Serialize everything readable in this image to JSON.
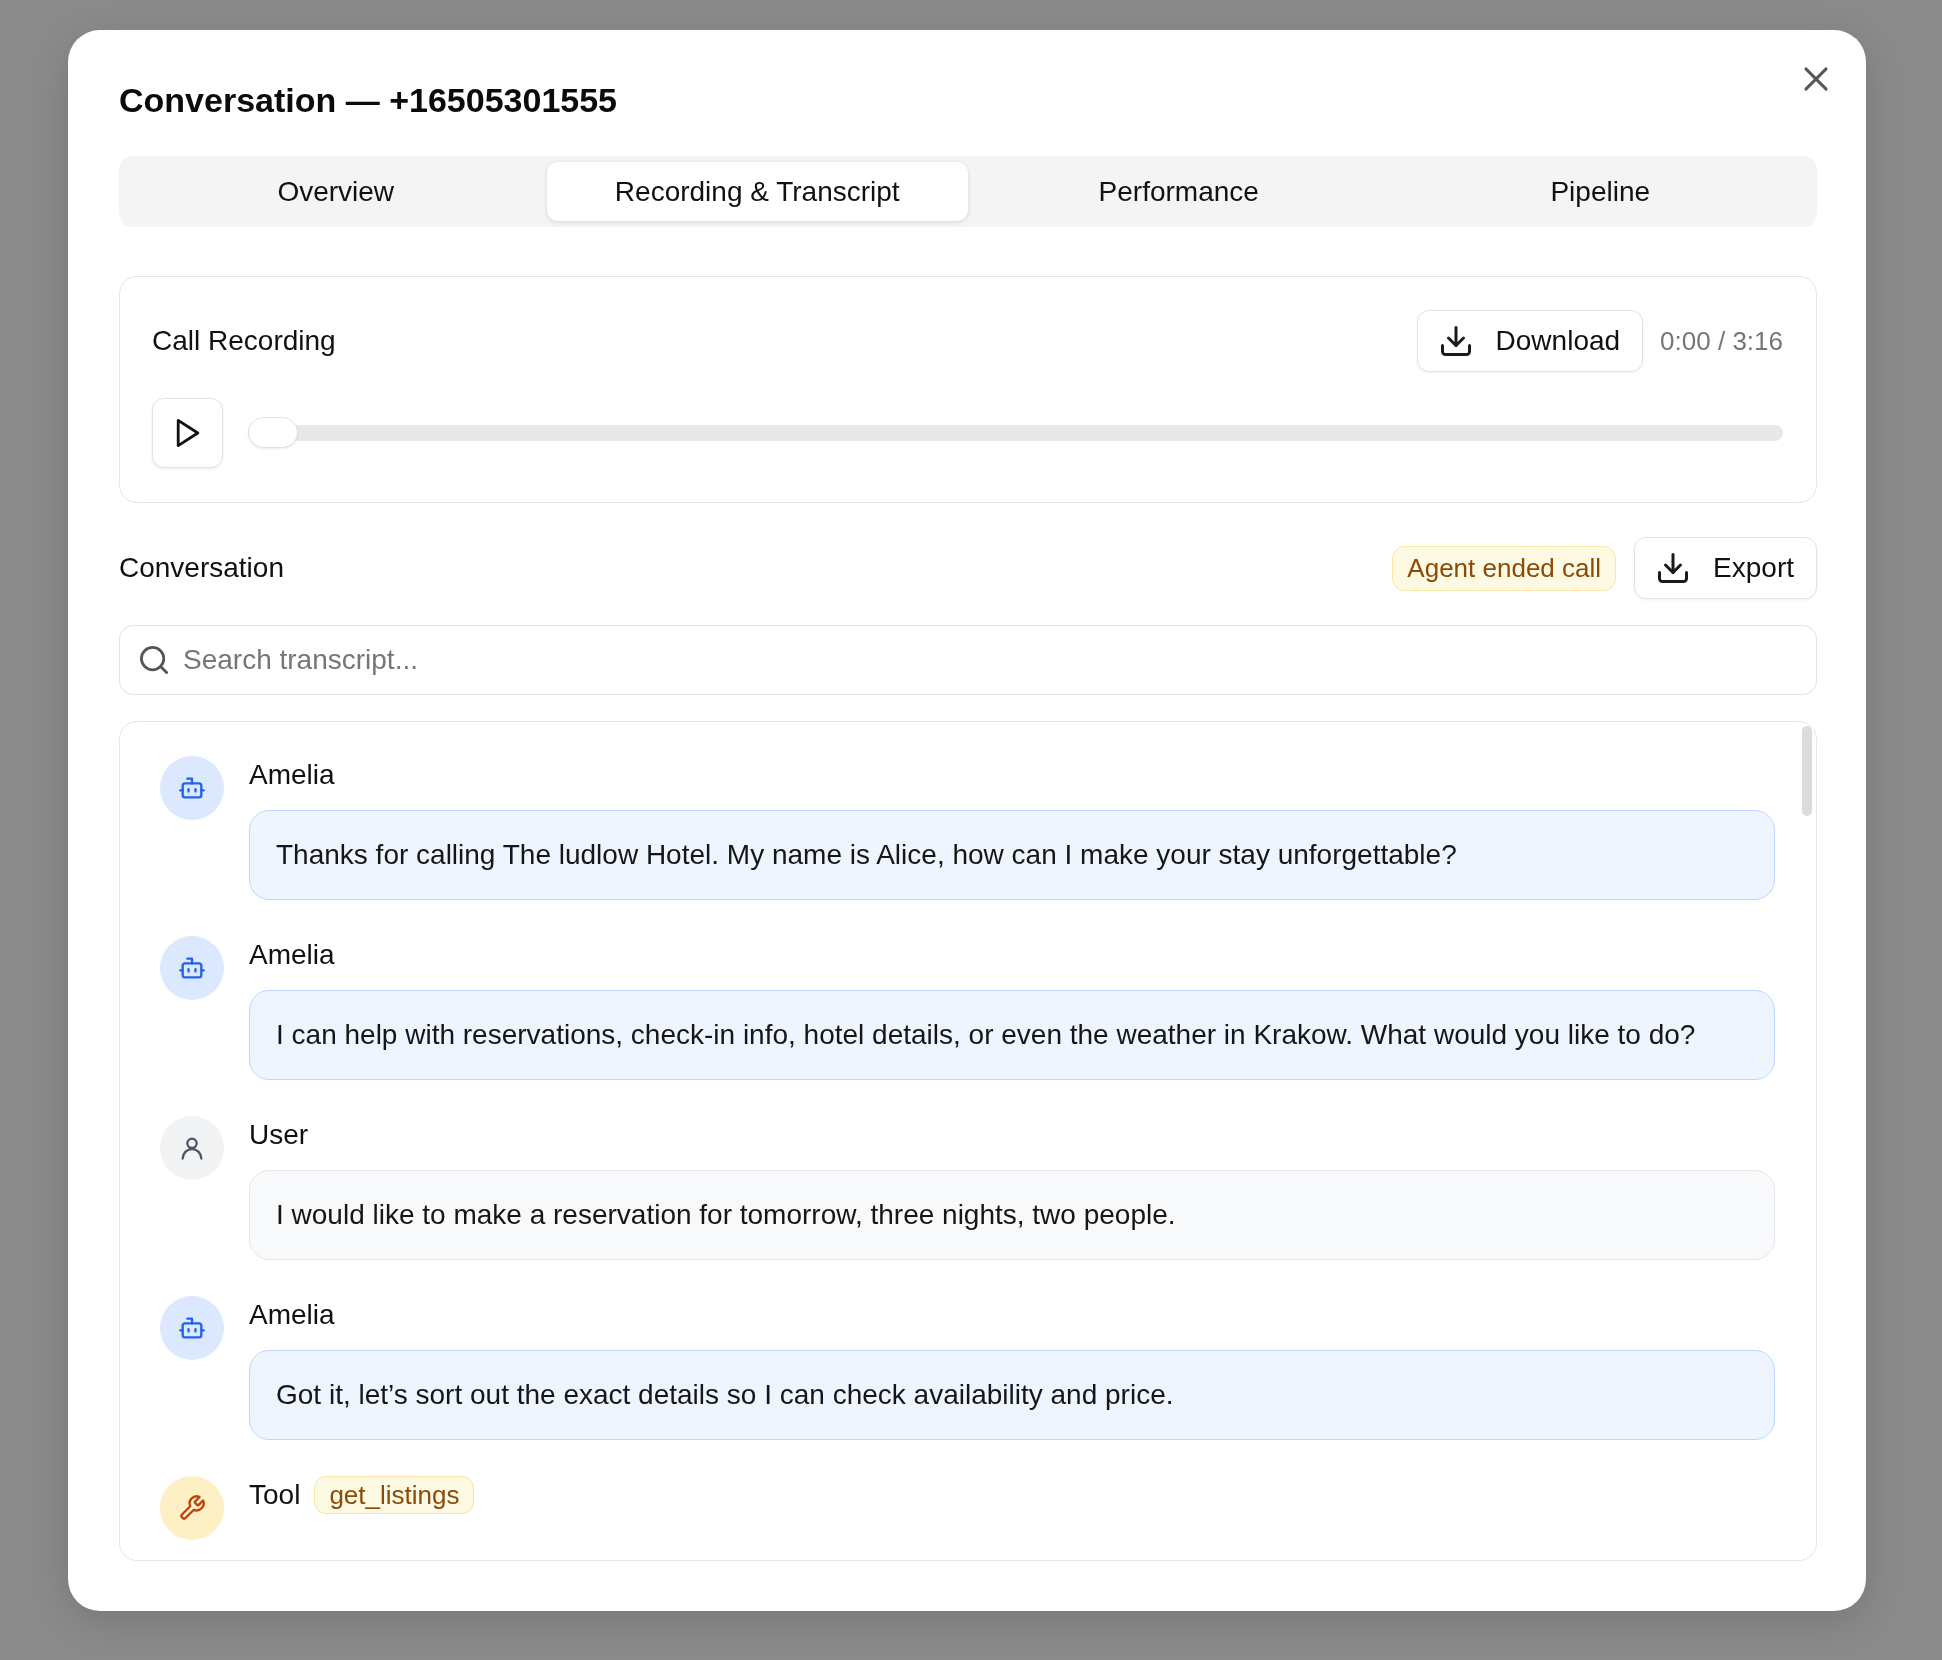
{
  "dialog": {
    "title": "Conversation — +16505301555"
  },
  "tabs": [
    {
      "label": "Overview",
      "selected": false
    },
    {
      "label": "Recording & Transcript",
      "selected": true
    },
    {
      "label": "Performance",
      "selected": false
    },
    {
      "label": "Pipeline",
      "selected": false
    }
  ],
  "recording": {
    "title": "Call Recording",
    "download_label": "Download",
    "time": "0:00 / 3:16",
    "playing": false,
    "level": 0
  },
  "conversation": {
    "title": "Conversation",
    "end_reason": "Agent ended call",
    "export_label": "Export",
    "search": {
      "placeholder": "Search transcript..."
    },
    "messages": [
      {
        "kind": "agent",
        "speaker": "Amelia",
        "text": "Thanks for calling The ludlow Hotel. My name is Alice, how can I make your stay unforgettable?"
      },
      {
        "kind": "agent",
        "speaker": "Amelia",
        "text": "I can help with reservations, check-in info, hotel details, or even the weather in Krakow. What would you like to do?"
      },
      {
        "kind": "user",
        "speaker": "User",
        "text": "I would like to make a reservation for tomorrow, three nights, two people."
      },
      {
        "kind": "agent",
        "speaker": "Amelia",
        "text": "Got it, let’s sort out the exact details so I can check availability and price."
      },
      {
        "kind": "tool",
        "speaker": "Tool",
        "tool_name": "get_listings"
      }
    ]
  }
}
